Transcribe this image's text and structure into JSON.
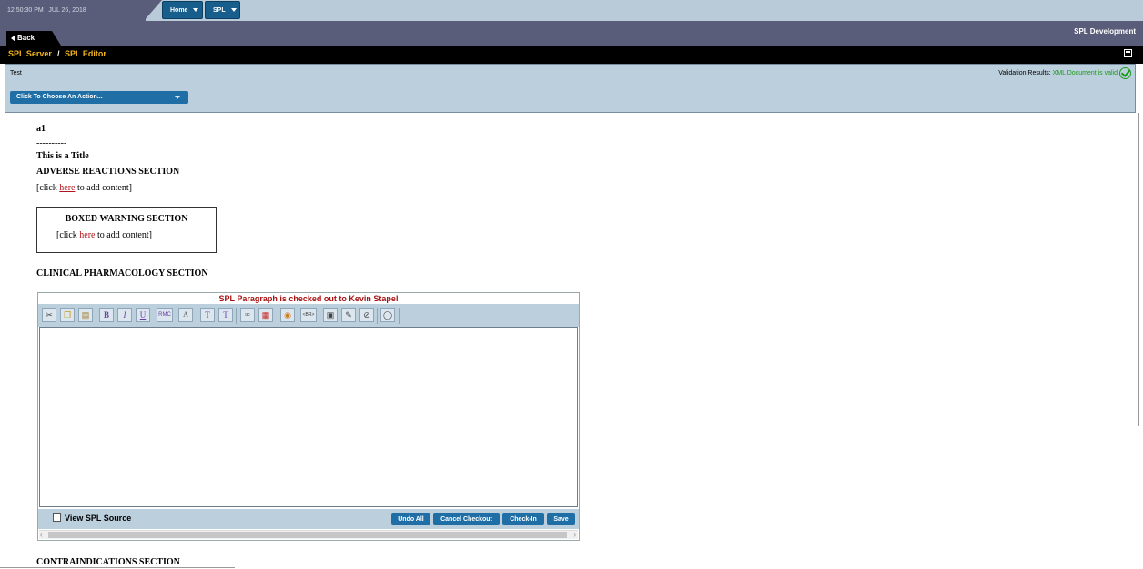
{
  "topbar": {
    "datetime": "12:50:30 PM | JUL 26, 2018",
    "nav": [
      {
        "label": "Home"
      },
      {
        "label": "SPL"
      }
    ]
  },
  "header": {
    "back_label": "Back",
    "app_title": "SPL Development"
  },
  "breadcrumb": {
    "items": [
      "SPL Server",
      "SPL Editor"
    ],
    "separator": "/"
  },
  "action_panel": {
    "document_name": "Test",
    "validation_label": "Validation Results:",
    "validation_value": "XML Document is valid",
    "action_select": "Click To Choose An Action..."
  },
  "document": {
    "code": "a1",
    "dashes": "----------",
    "title": "This is a Title",
    "section1": "ADVERSE REACTIONS SECTION",
    "add_prefix": "[click ",
    "add_link": "here",
    "add_suffix": " to add content]",
    "boxed_title": "BOXED WARNING SECTION",
    "section3": "CLINICAL PHARMACOLOGY SECTION",
    "section4": "CONTRAINDICATIONS SECTION"
  },
  "editor": {
    "status": "SPL Paragraph is checked out to Kevin Stapel",
    "view_source_label": "View SPL Source",
    "buttons": {
      "undo_all": "Undo All",
      "cancel_checkout": "Cancel Checkout",
      "check_in": "Check-In",
      "save": "Save"
    },
    "toolbar": {
      "bold": "B",
      "italic": "I",
      "underline": "U",
      "rmc": "RMC",
      "superscript": "T",
      "subscript": "T",
      "br": "<BR>"
    }
  },
  "colors": {
    "nav_blue": "#185e8c",
    "header_gray": "#5a5d7a",
    "crumb_gold": "#f2b51d",
    "panel_blue": "#bccfdc",
    "valid_green": "#1a9a1a",
    "checkout_red": "#a81111"
  }
}
